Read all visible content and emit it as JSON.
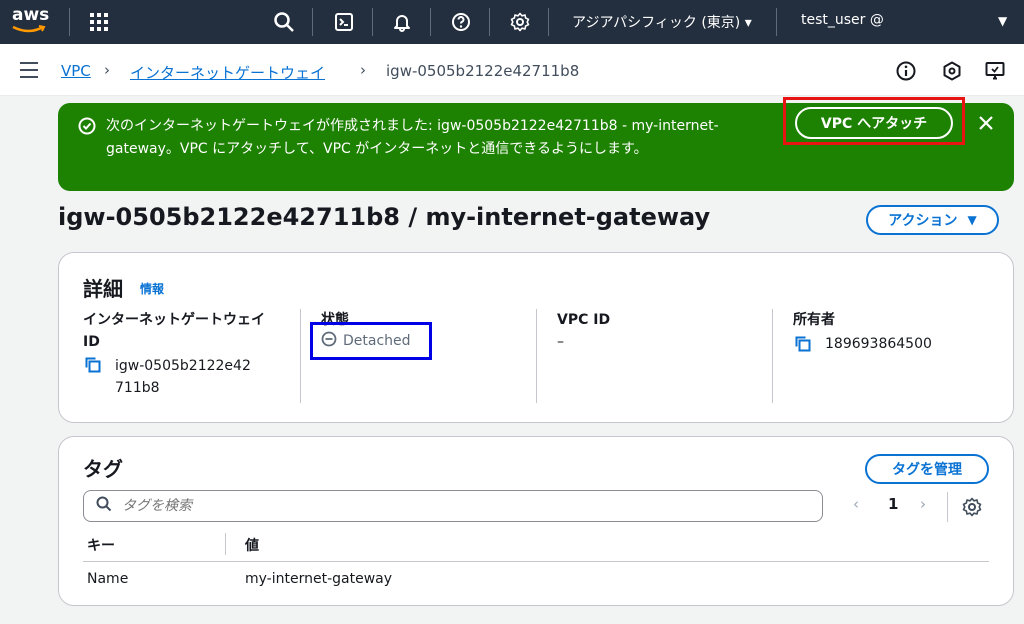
{
  "topbar": {
    "logo_text": "aws",
    "region": "アジアパシフィック (東京) ▾",
    "user": "test_user @"
  },
  "breadcrumb": {
    "items": [
      "VPC",
      "インターネットゲートウェイ"
    ],
    "current": "igw-0505b2122e42711b8"
  },
  "flash": {
    "message": "次のインターネットゲートウェイが作成されました: igw-0505b2122e42711b8 - my-internet-gateway。VPC にアタッチして、VPC がインターネットと通信できるようにします。",
    "button_label": "VPC へアタッチ",
    "type": "success"
  },
  "page": {
    "title": "igw-0505b2122e42711b8 / my-internet-gateway",
    "actions_label": "アクション"
  },
  "details": {
    "title": "詳細",
    "info_label": "情報",
    "columns": [
      {
        "label": "インターネットゲートウェイ ID",
        "value": "igw-0505b2122e42711b8"
      },
      {
        "label": "状態",
        "value": "Detached"
      },
      {
        "label": "VPC ID",
        "value": "–"
      },
      {
        "label": "所有者",
        "value": "189693864500"
      }
    ]
  },
  "tags": {
    "title": "タグ",
    "manage_label": "タグを管理",
    "search_placeholder": "タグを検索",
    "page_number": "1",
    "headers": [
      "キー",
      "値"
    ],
    "rows": [
      {
        "key": "Name",
        "value": "my-internet-gateway"
      }
    ]
  },
  "colors": {
    "topbar_bg": "#232f3e",
    "flash_bg": "#1d8102",
    "link": "#0972d3",
    "annotation_red": "#e81313",
    "annotation_blue": "#0000e6"
  }
}
